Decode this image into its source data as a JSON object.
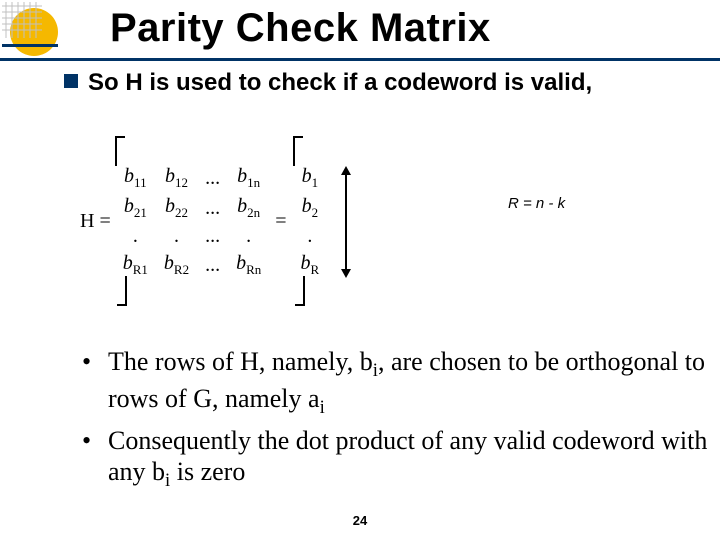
{
  "title": "Parity Check Matrix",
  "lead": "So H is used to check if a codeword is valid,",
  "matrix": {
    "lhs": "H =",
    "eq": "=",
    "big": [
      [
        "b",
        "11",
        "b",
        "12",
        "...",
        "b",
        "1n"
      ],
      [
        "b",
        "21",
        "b",
        "22",
        "...",
        "b",
        "2n"
      ],
      [
        ".",
        "",
        ".",
        "",
        "...",
        ".",
        ""
      ],
      [
        "b",
        "R1",
        "b",
        "R2",
        "...",
        "b",
        "Rn"
      ]
    ],
    "vec": [
      [
        "b",
        "1"
      ],
      [
        "b",
        "2"
      ],
      [
        ".",
        ""
      ],
      [
        "b",
        "R"
      ]
    ],
    "dim_label": "R = n - k"
  },
  "bullets": [
    {
      "pre": "The rows of H, namely, b",
      "sub1": "i",
      "mid": ", are chosen to be orthogonal to rows of G, namely a",
      "sub2": "i",
      "post": ""
    },
    {
      "pre": "Consequently the dot product of any valid codeword with any b",
      "sub1": "i",
      "mid": " is zero",
      "sub2": "",
      "post": ""
    }
  ],
  "slide_number": "24"
}
